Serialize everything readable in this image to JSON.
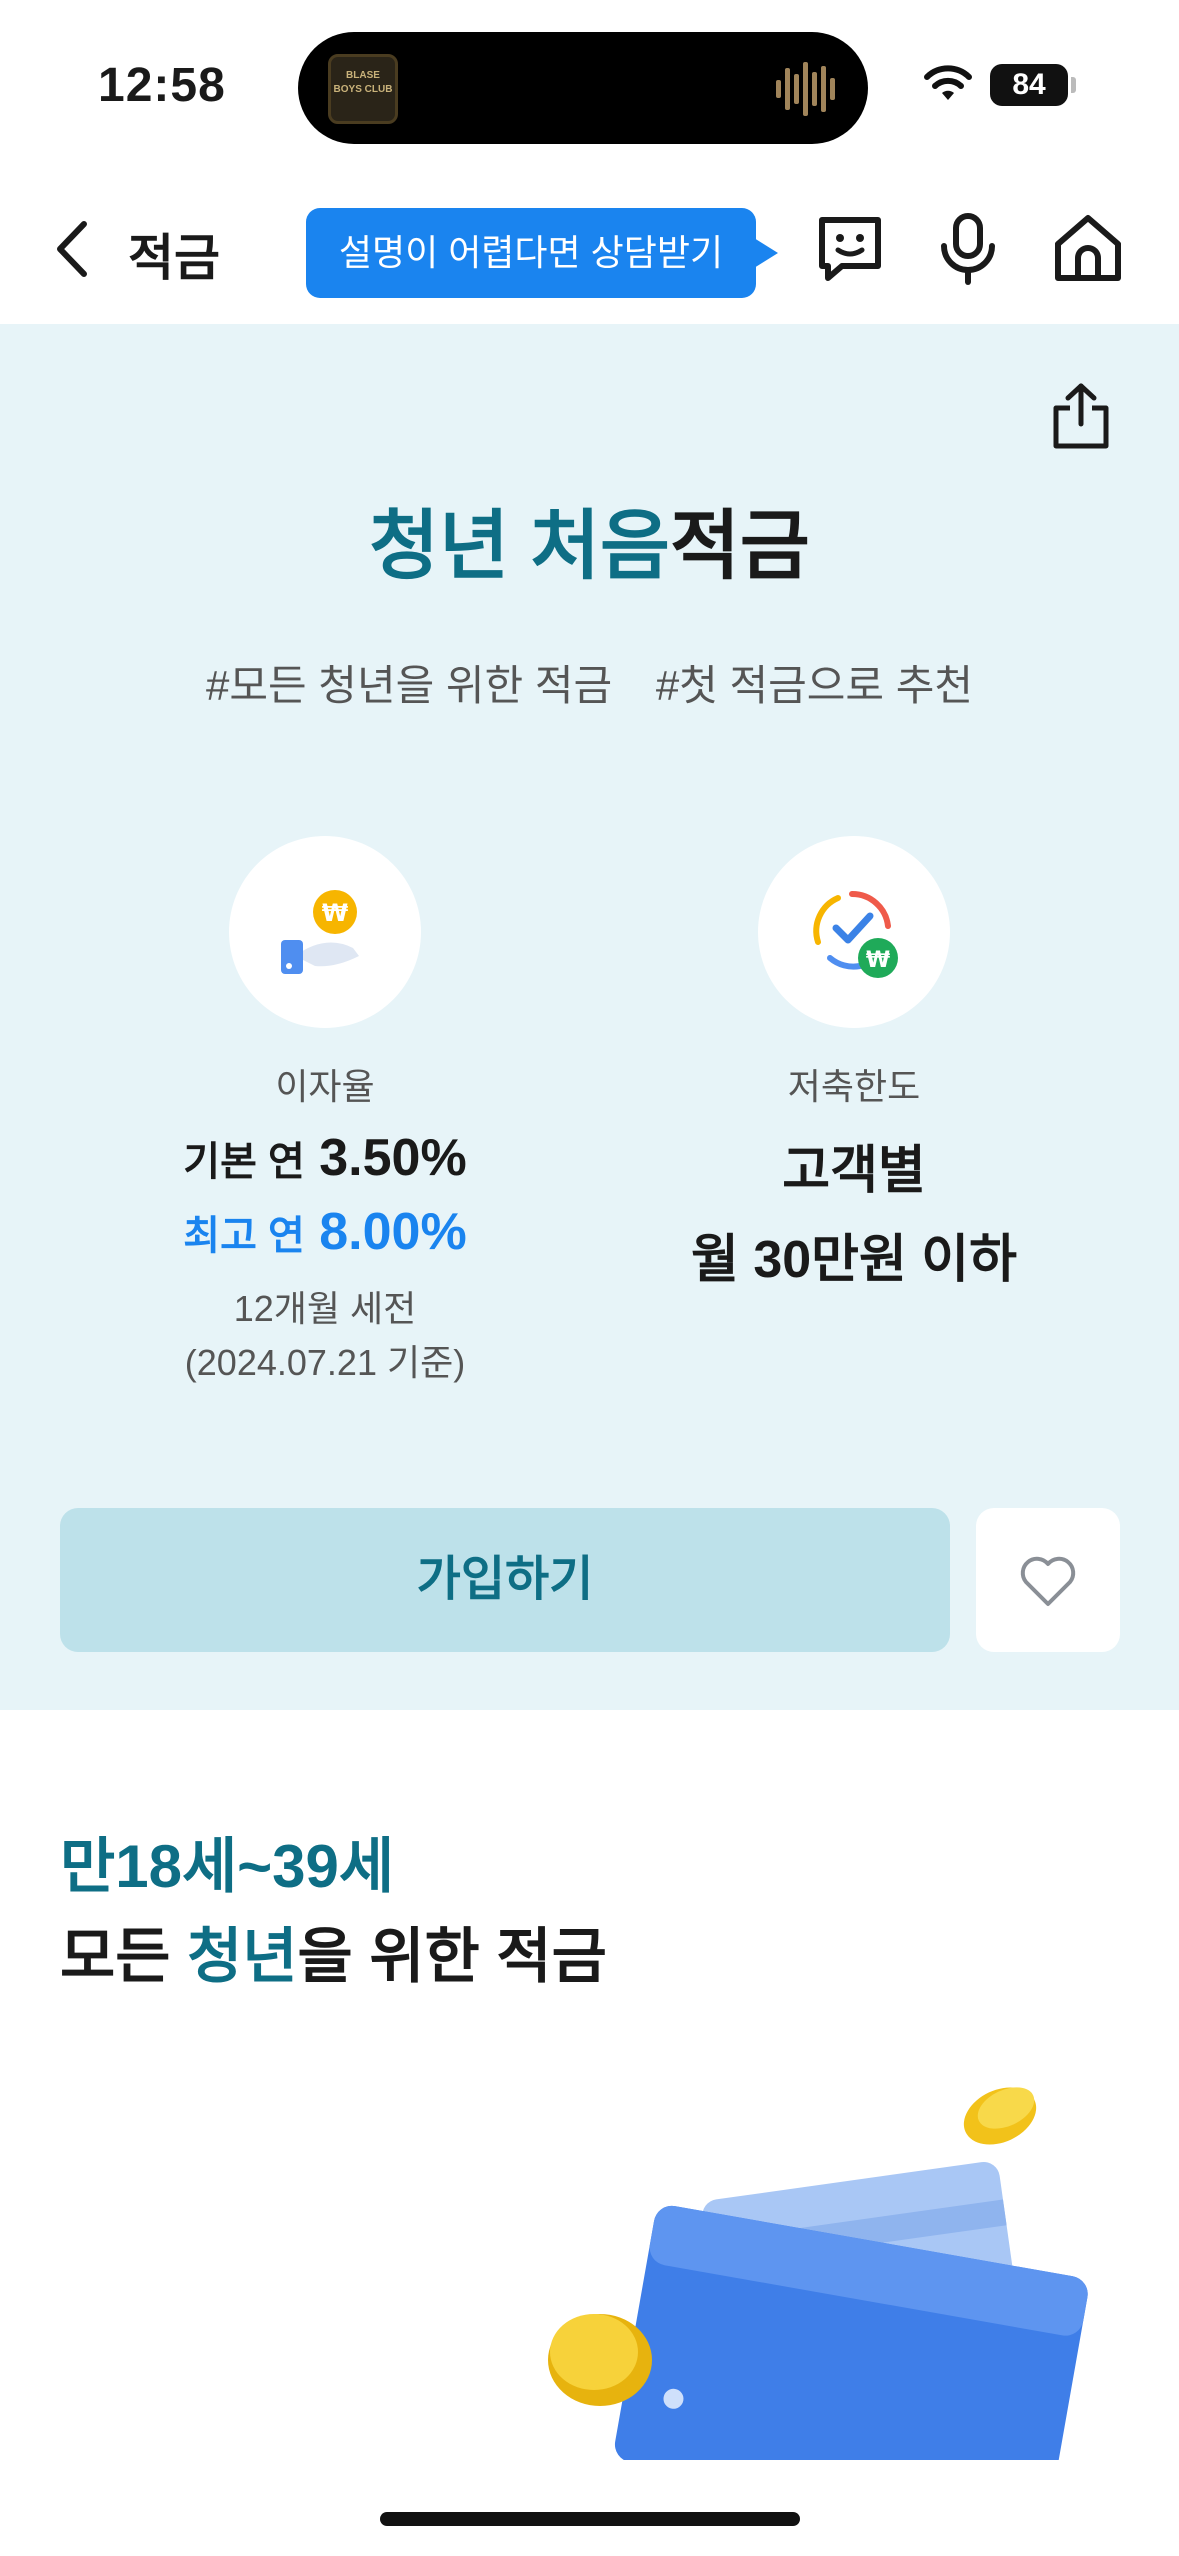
{
  "status": {
    "time": "12:58",
    "battery": "84",
    "island_art_text": "BLASE BOYS CLUB"
  },
  "header": {
    "title": "적금",
    "consult": "설명이 어렵다면 상담받기"
  },
  "product": {
    "title_accent": "청년 처음",
    "title_rest": "적금",
    "tags": [
      "#모든 청년을 위한 적금",
      "#첫 적금으로 추천"
    ]
  },
  "features": {
    "rate": {
      "label": "이자율",
      "base_prefix": "기본 연",
      "base_value": "3.50%",
      "max_prefix": "최고 연",
      "max_value": "8.00%",
      "note_1": "12개월 세전",
      "note_2": "(2024.07.21 기준)"
    },
    "limit": {
      "label": "저축한도",
      "line_1": "고객별",
      "line_2": "월 30만원 이하"
    }
  },
  "actions": {
    "join": "가입하기"
  },
  "section": {
    "age": "만18세~39세",
    "title_pre": "모든 ",
    "title_accent": "청년",
    "title_post": "을 위한 적금"
  },
  "colors": {
    "accent_teal": "#0e6e85",
    "accent_blue": "#1a84ef",
    "hero_bg": "#e7f4f8",
    "button_bg": "#bde1ea"
  },
  "icons": [
    "back-icon",
    "chat-icon",
    "mic-icon",
    "home-icon",
    "share-icon",
    "heart-icon",
    "hand-coin-icon",
    "check-cycle-icon"
  ]
}
